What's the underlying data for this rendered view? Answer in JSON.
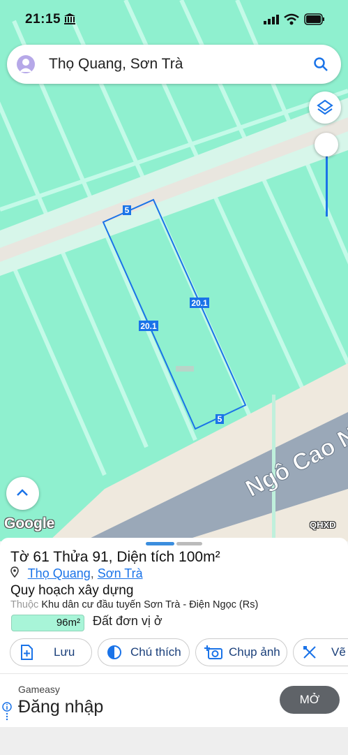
{
  "status_bar": {
    "time": "21:15"
  },
  "search": {
    "query": "Thọ Quang, Sơn Trà"
  },
  "map": {
    "street_name": "Ngô Cao N",
    "parcel_dimensions": {
      "top": "5",
      "left": "20.1",
      "right": "20.1",
      "bottom": "5"
    },
    "attribution": "Google",
    "layer_tag": "QHXD",
    "colors": {
      "zone": "#8ff0cf",
      "boundary": "#1a73e8",
      "road": "#9aa8b8"
    }
  },
  "parcel": {
    "title": "Tờ 61 Thửa 91, Diện tích 100m²",
    "ward": "Thọ Quang",
    "district": "Sơn Trà",
    "zone_title": "Quy hoạch xây dựng",
    "belongs_prefix": "Thuộc",
    "belongs_value": "Khu dân cư đầu tuyến Sơn Trà - Điện Ngọc (Rs)",
    "area_value": "96m²",
    "area_fraction": 0.96,
    "area_label": "Đất đơn vị ở"
  },
  "actions": [
    {
      "label": "Lưu",
      "icon": "add-file-icon"
    },
    {
      "label": "Chú thích",
      "icon": "legend-icon"
    },
    {
      "label": "Chụp ảnh",
      "icon": "camera-icon"
    },
    {
      "label": "Vẽ",
      "icon": "draw-icon"
    }
  ],
  "ad": {
    "brand": "Gameasy",
    "headline": "Đăng nhập",
    "cta": "MỞ"
  }
}
